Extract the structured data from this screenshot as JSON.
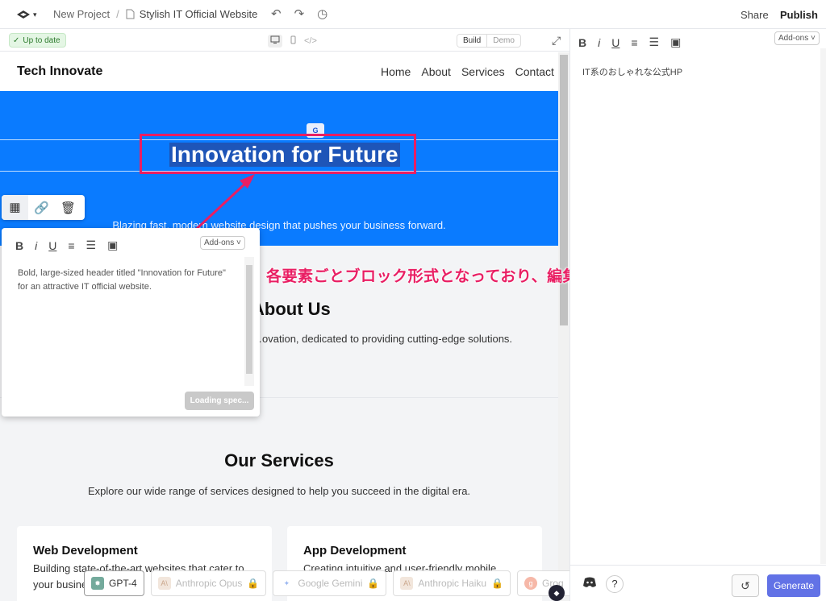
{
  "topbar": {
    "project": "New Project",
    "separator": "/",
    "file": "Stylish IT Official Website",
    "share": "Share",
    "publish": "Publish"
  },
  "subbar": {
    "status": "Up to date",
    "mode_build": "Build",
    "mode_demo": "Demo"
  },
  "site": {
    "brand": "Tech Innovate",
    "nav": [
      "Home",
      "About",
      "Services",
      "Contact"
    ],
    "hero_title": "Innovation for Future",
    "hero_subtitle": "Blazing fast, modern website design that pushes your business forward.",
    "about_title": "About Us",
    "about_text": "…ovation, dedicated to providing cutting-edge solutions.",
    "services_title": "Our Services",
    "services_subtitle": "Explore our wide range of services designed to help you succeed in the digital era.",
    "cards": [
      {
        "title": "Web Development",
        "text": "Building state-of-the-art websites that cater to your business"
      },
      {
        "title": "App Development",
        "text": "Creating intuitive and user-friendly mobile"
      }
    ]
  },
  "popup": {
    "addons": "Add-ons",
    "prompt": "Bold, large-sized header titled \"Innovation for Future\" for an attractive IT official website.",
    "loading": "Loading spec..."
  },
  "annotation": "各要素ごとブロック形式となっており、編集ができます",
  "models": [
    {
      "label": "GPT-4",
      "active": true
    },
    {
      "label": "Anthropic Opus",
      "active": false
    },
    {
      "label": "Google Gemini",
      "active": false
    },
    {
      "label": "Anthropic Haiku",
      "active": false
    },
    {
      "label": "Groq",
      "active": false
    }
  ],
  "right_panel": {
    "addons": "Add-ons",
    "text": "IT系のおしゃれな公式HP",
    "generate": "Generate"
  },
  "colors": {
    "accent": "#0a7bff",
    "highlight": "#e91e63",
    "generate": "#6272e6"
  }
}
